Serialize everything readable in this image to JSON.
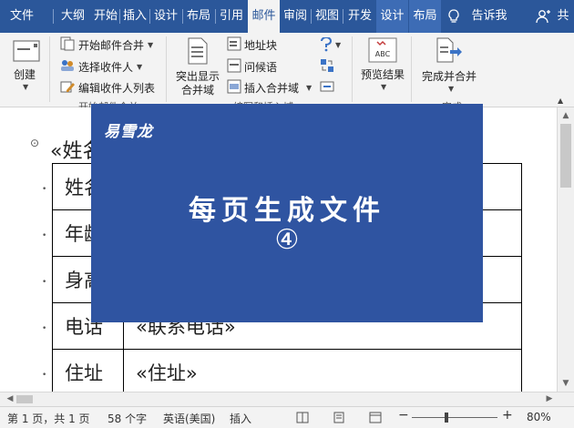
{
  "tabs": {
    "file": "文件",
    "outline": "大纲",
    "home": "开始",
    "insert": "插入",
    "design": "设计",
    "layout": "布局",
    "references": "引用",
    "mailings": "邮件",
    "review": "审阅",
    "view": "视图",
    "developer": "开发",
    "ctx_design": "设计",
    "ctx_layout": "布局",
    "tell_me": "告诉我",
    "share": "共"
  },
  "ribbon": {
    "create": {
      "label": "创建"
    },
    "start_mail_merge": {
      "start_merge": "开始邮件合并",
      "select_recipients": "选择收件人",
      "edit_recipients": "编辑收件人列表",
      "group_label": "开始邮件合并"
    },
    "fields": {
      "highlight_line1": "突出显示",
      "highlight_line2": "合并域",
      "address_block": "地址块",
      "greeting_line": "问候语",
      "insert_merge_field": "插入合并域",
      "group_label": "编写和插入域"
    },
    "preview": {
      "label": "预览结果",
      "icon_text": "ABC"
    },
    "finish": {
      "label": "完成并合并",
      "group_label": "完成"
    }
  },
  "document": {
    "name_paragraph": "«姓名»",
    "rows": [
      {
        "label": "姓名",
        "value": ""
      },
      {
        "label": "年龄",
        "value": ""
      },
      {
        "label": "身高",
        "value": ""
      },
      {
        "label": "电话",
        "value": "«联系电话»"
      },
      {
        "label": "住址",
        "value": "«住址»"
      }
    ]
  },
  "overlay": {
    "logo": "易雪龙",
    "title": "每页生成文件",
    "number": "④"
  },
  "status": {
    "page": "第 1 页，共 1 页",
    "words": "58 个字",
    "language": "英语(美国)",
    "mode": "插入",
    "zoom": "80%"
  },
  "colors": {
    "accent": "#2b579a",
    "overlay": "#2f54a1"
  }
}
